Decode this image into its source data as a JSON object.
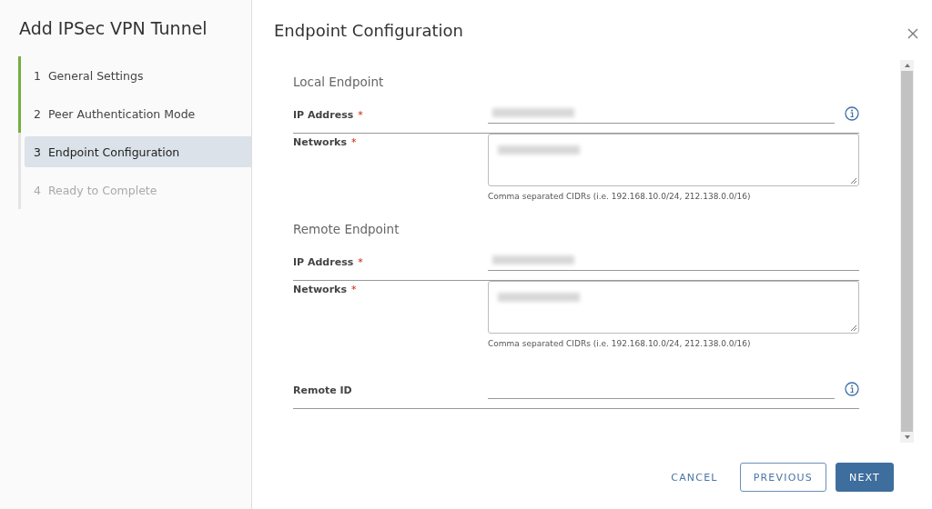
{
  "sidebar": {
    "title": "Add IPSec VPN Tunnel",
    "steps": [
      {
        "number": "1",
        "label": "General Settings",
        "completed": true,
        "selected": false,
        "disabled": false
      },
      {
        "number": "2",
        "label": "Peer Authentication Mode",
        "completed": true,
        "selected": false,
        "disabled": false
      },
      {
        "number": "3",
        "label": "Endpoint Configuration",
        "completed": false,
        "selected": true,
        "disabled": false
      },
      {
        "number": "4",
        "label": "Ready to Complete",
        "completed": false,
        "selected": false,
        "disabled": true
      }
    ]
  },
  "page": {
    "title": "Endpoint Configuration"
  },
  "sections": [
    {
      "heading": "Local Endpoint",
      "fields": [
        {
          "label": "IP Address",
          "kind": "input",
          "required_mark": "*",
          "info": true,
          "redacted": true
        },
        {
          "label": "Networks",
          "kind": "textarea",
          "required_mark": "*",
          "info": false,
          "redacted": true,
          "hint": "Comma separated CIDRs (i.e. 192.168.10.0/24, 212.138.0.0/16)"
        }
      ]
    },
    {
      "heading": "Remote Endpoint",
      "fields": [
        {
          "label": "IP Address",
          "kind": "input",
          "required_mark": "*",
          "info": false,
          "redacted": true
        },
        {
          "label": "Networks",
          "kind": "textarea",
          "required_mark": "*",
          "info": false,
          "redacted": true,
          "hint": "Comma separated CIDRs (i.e. 192.168.10.0/24, 212.138.0.0/16)"
        },
        {
          "label": "Remote ID",
          "kind": "input",
          "info": true,
          "redacted": false
        }
      ]
    }
  ],
  "buttons": [
    {
      "label": "CANCEL",
      "kind": "flat"
    },
    {
      "label": "PREVIOUS",
      "kind": "outline"
    },
    {
      "label": "NEXT",
      "kind": "primary"
    }
  ]
}
